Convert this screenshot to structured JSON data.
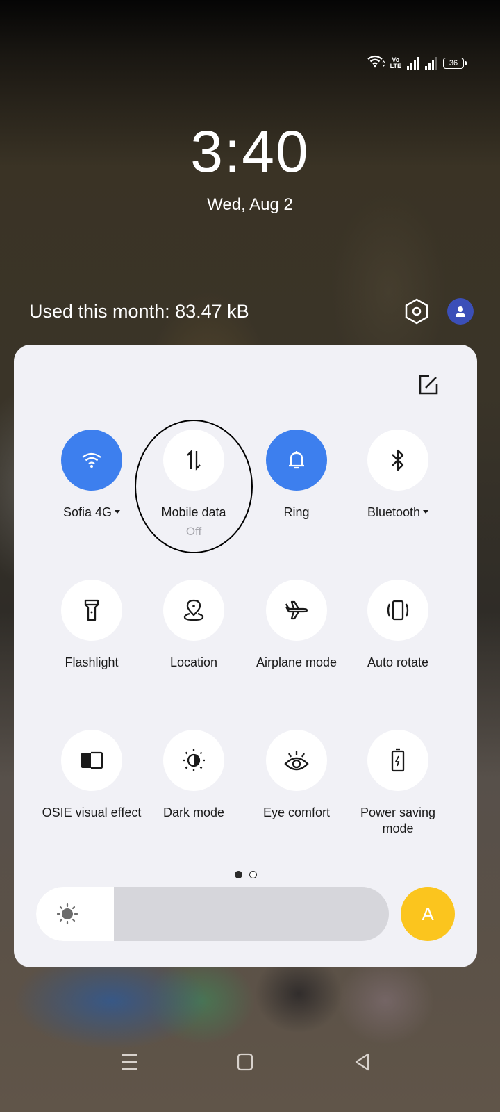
{
  "status_bar": {
    "network": "VoLTE",
    "volte_top": "Vo",
    "volte_bottom": "LTE",
    "battery_level": "36",
    "icons": [
      "wifi-icon",
      "volte-icon",
      "signal-sim1-icon",
      "signal-sim2-icon",
      "battery-icon"
    ]
  },
  "lockscreen": {
    "time": "3:40",
    "date": "Wed, Aug 2"
  },
  "header": {
    "data_usage": "Used this month: 83.47 kB",
    "settings_icon": "settings-hexagon-icon",
    "avatar_icon": "user-icon"
  },
  "quick_settings": {
    "edit_icon": "edit-icon",
    "accent_color": "#3d7fee",
    "tiles": [
      {
        "label": "Sofia 4G",
        "icon": "wifi-icon",
        "active": true,
        "has_dropdown": true
      },
      {
        "label": "Mobile data",
        "sub": "Off",
        "icon": "mobile-data-icon",
        "active": false
      },
      {
        "label": "Ring",
        "icon": "bell-icon",
        "active": true
      },
      {
        "label": "Bluetooth",
        "icon": "bluetooth-icon",
        "active": false,
        "has_dropdown": true
      },
      {
        "label": "Flashlight",
        "icon": "flashlight-icon",
        "active": false
      },
      {
        "label": "Location",
        "icon": "location-icon",
        "active": false
      },
      {
        "label": "Airplane mode",
        "icon": "airplane-icon",
        "active": false
      },
      {
        "label": "Auto rotate",
        "icon": "auto-rotate-icon",
        "active": false
      },
      {
        "label": "OSIE visual effect",
        "icon": "osie-icon",
        "active": false
      },
      {
        "label": "Dark mode",
        "icon": "dark-mode-icon",
        "active": false
      },
      {
        "label": "Eye comfort",
        "icon": "eye-icon",
        "active": false
      },
      {
        "label": "Power saving mode",
        "icon": "battery-saver-icon",
        "active": false
      }
    ],
    "page_indicator": {
      "current": 1,
      "total": 2
    },
    "brightness": {
      "level_percent": 22,
      "auto_label": "A",
      "auto_color": "#fbc51e"
    }
  },
  "nav_bar": {
    "buttons": [
      "menu",
      "home",
      "back"
    ]
  }
}
